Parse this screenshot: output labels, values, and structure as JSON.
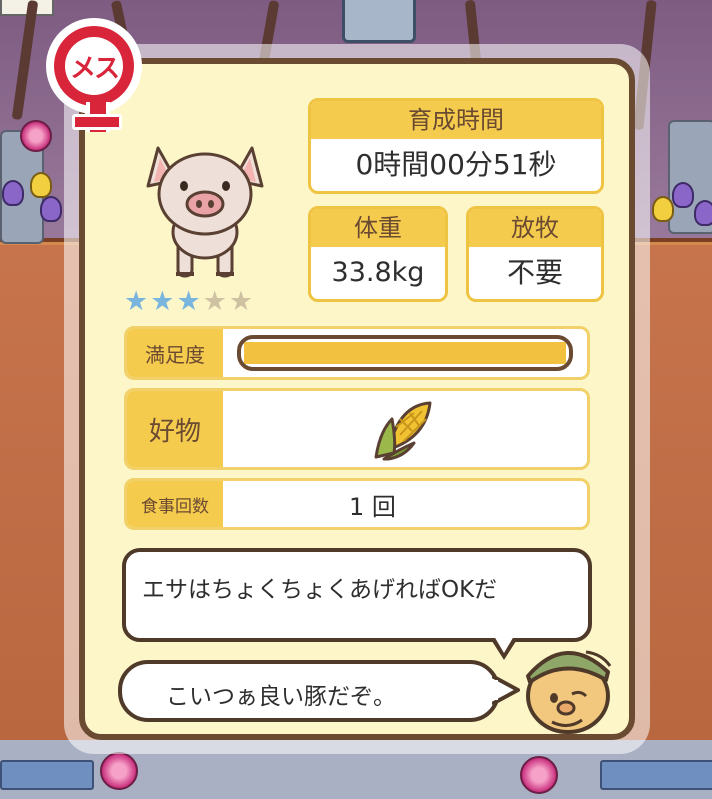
{
  "pig": {
    "gender_label": "メス",
    "stars_filled": 3,
    "stars_total": 5,
    "star_glyphs": [
      "★",
      "★",
      "★",
      "★",
      "★"
    ]
  },
  "stats": {
    "raise_time": {
      "label": "育成時間",
      "value": "0時間00分51秒"
    },
    "weight": {
      "label": "体重",
      "value": "33.8kg"
    },
    "grazing": {
      "label": "放牧",
      "value": "不要"
    }
  },
  "satisfaction": {
    "label": "満足度",
    "level": 1.0
  },
  "favorite": {
    "label": "好物",
    "item_icon": "corn-icon"
  },
  "meals": {
    "label": "食事回数",
    "value": "1 回"
  },
  "dialogue": {
    "tip": "エサはちょくちょくあげればOKだ",
    "comment": "こいつぁ良い豚だぞ。"
  },
  "colors": {
    "panel_bg": "#fdf6c9",
    "header_yellow": "#f5cb4d",
    "border_brown": "#6b4a32",
    "female_red": "#d8253a",
    "star_blue": "#7ab5dd",
    "star_grey": "#cfc2a2"
  }
}
